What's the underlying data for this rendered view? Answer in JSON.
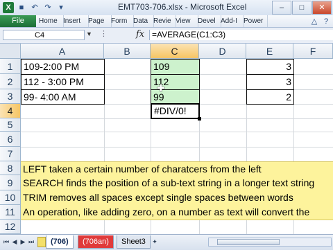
{
  "window": {
    "title": "EMT703-706.xlsx - Microsoft Excel"
  },
  "ribbon": {
    "file_tab": "File",
    "tabs": [
      "Home",
      "Insert",
      "Page",
      "Form",
      "Data",
      "Revie",
      "View",
      "Devel",
      "Add-I",
      "Power"
    ]
  },
  "formula_bar": {
    "name_box": "C4",
    "fx": "fx",
    "formula": "=AVERAGE(C1:C3)"
  },
  "columns": [
    "A",
    "B",
    "C",
    "D",
    "E",
    "F"
  ],
  "rows": [
    "1",
    "2",
    "3",
    "4",
    "5",
    "6",
    "7",
    "8",
    "9",
    "10",
    "11",
    "12"
  ],
  "cells": {
    "A1": "109-2:00 PM",
    "A2": "112 - 3:00 PM",
    "A3": "99- 4:00 AM",
    "C1": "109",
    "C2": "112",
    "C3": "99",
    "C4": "#DIV/0!",
    "E1": "3",
    "E2": "3",
    "E3": "2",
    "A8": "LEFT taken a certain number of charatcers from the left",
    "A9": "SEARCH finds the position of a sub-text string in a longer text string",
    "A10": "TRIM removes all spaces except single spaces between words",
    "A11": "An operation, like adding zero, on a number as text will convert the"
  },
  "sheet_tabs": [
    "(706)",
    "(706an)",
    "Sheet3"
  ],
  "colors": {
    "green_fill": "#cdf2cd",
    "yellow_fill": "#fdf39c",
    "red_tab": "#e03a3a",
    "file_tab": "#217346"
  }
}
